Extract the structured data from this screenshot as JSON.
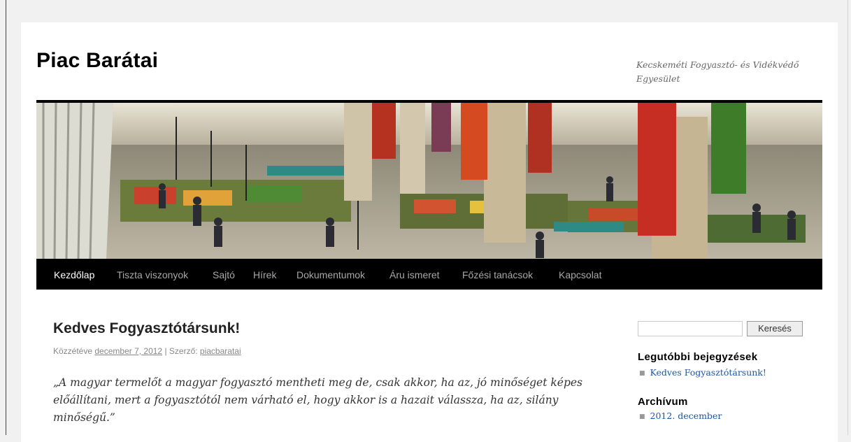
{
  "site": {
    "title": "Piac Barátai",
    "description": "Kecskeméti Fogyasztó- és Vidékvédő Egyesület"
  },
  "nav": {
    "items": [
      "Kezdőlap",
      "Tiszta viszonyok",
      "Sajtó",
      "Hírek",
      "Dokumentumok",
      "Áru ismeret",
      "Főzési tanácsok",
      "Kapcsolat"
    ],
    "active": "Kezdőlap"
  },
  "post": {
    "title": "Kedves Fogyasztótársunk!",
    "meta_prefix": "Közzétéve ",
    "date": "december 7, 2012",
    "meta_sep": " | Szerző: ",
    "author": "piacbaratai",
    "quote": "„A magyar termelőt a magyar fogyasztó mentheti meg de, csak akkor, ha az, jó minőséget képes előállítani, mert a fogyasztótól nem várható el, hogy akkor is a hazait válassza, ha az, silány minőségű.”"
  },
  "sidebar": {
    "search_button": "Keresés",
    "recent_title": "Legutóbbi bejegyzések",
    "recent_items": [
      "Kedves Fogyasztótársunk!"
    ],
    "archive_title": "Archívum",
    "archive_items": [
      "2012. december"
    ]
  },
  "colors": {
    "nav_background": "#000000",
    "nav_active": "#ffffff",
    "nav_inactive": "#a8a8a8",
    "link": "#1b57a2"
  }
}
